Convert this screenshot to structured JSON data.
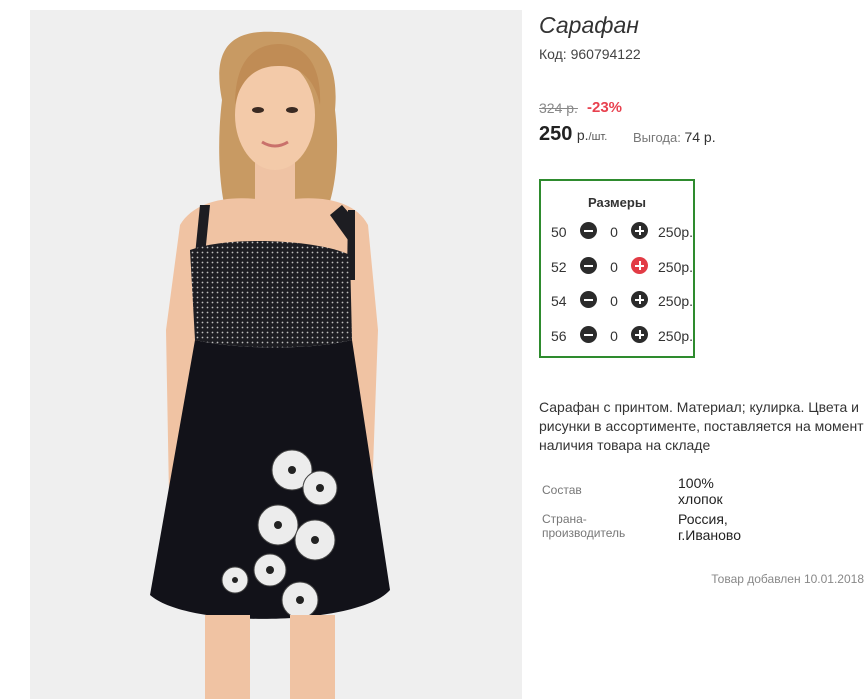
{
  "product": {
    "title": "Сарафан",
    "code": "Код: 960794122",
    "old_price": "324 р.",
    "discount": "-23%",
    "price_value": "250",
    "price_currency": "р.",
    "price_unit": "/шт.",
    "benefit_label": "Выгода:",
    "benefit_value": "74 р."
  },
  "sizes": {
    "title": "Размеры",
    "rows": [
      {
        "size": "50",
        "qty": "0",
        "price": "250р."
      },
      {
        "size": "52",
        "qty": "0",
        "price": "250р."
      },
      {
        "size": "54",
        "qty": "0",
        "price": "250р."
      },
      {
        "size": "56",
        "qty": "0",
        "price": "250р."
      }
    ]
  },
  "description": "Сарафан с принтом. Материал; кулирка. Цвета и рисунки в ассортименте, поставляется на момент наличия товара на складе",
  "properties": [
    {
      "label": "Состав",
      "value_line1": "100%",
      "value_line2": "хлопок"
    },
    {
      "label_line1": "Страна-",
      "label_line2": "производитель",
      "value_line1": "Россия,",
      "value_line2": "г.Иваново"
    }
  ],
  "added": "Товар добавлен 10.01.2018",
  "colors": {
    "box_border": "#2e8b2e",
    "discount": "#e8414f",
    "active_plus": "#e23b45"
  }
}
